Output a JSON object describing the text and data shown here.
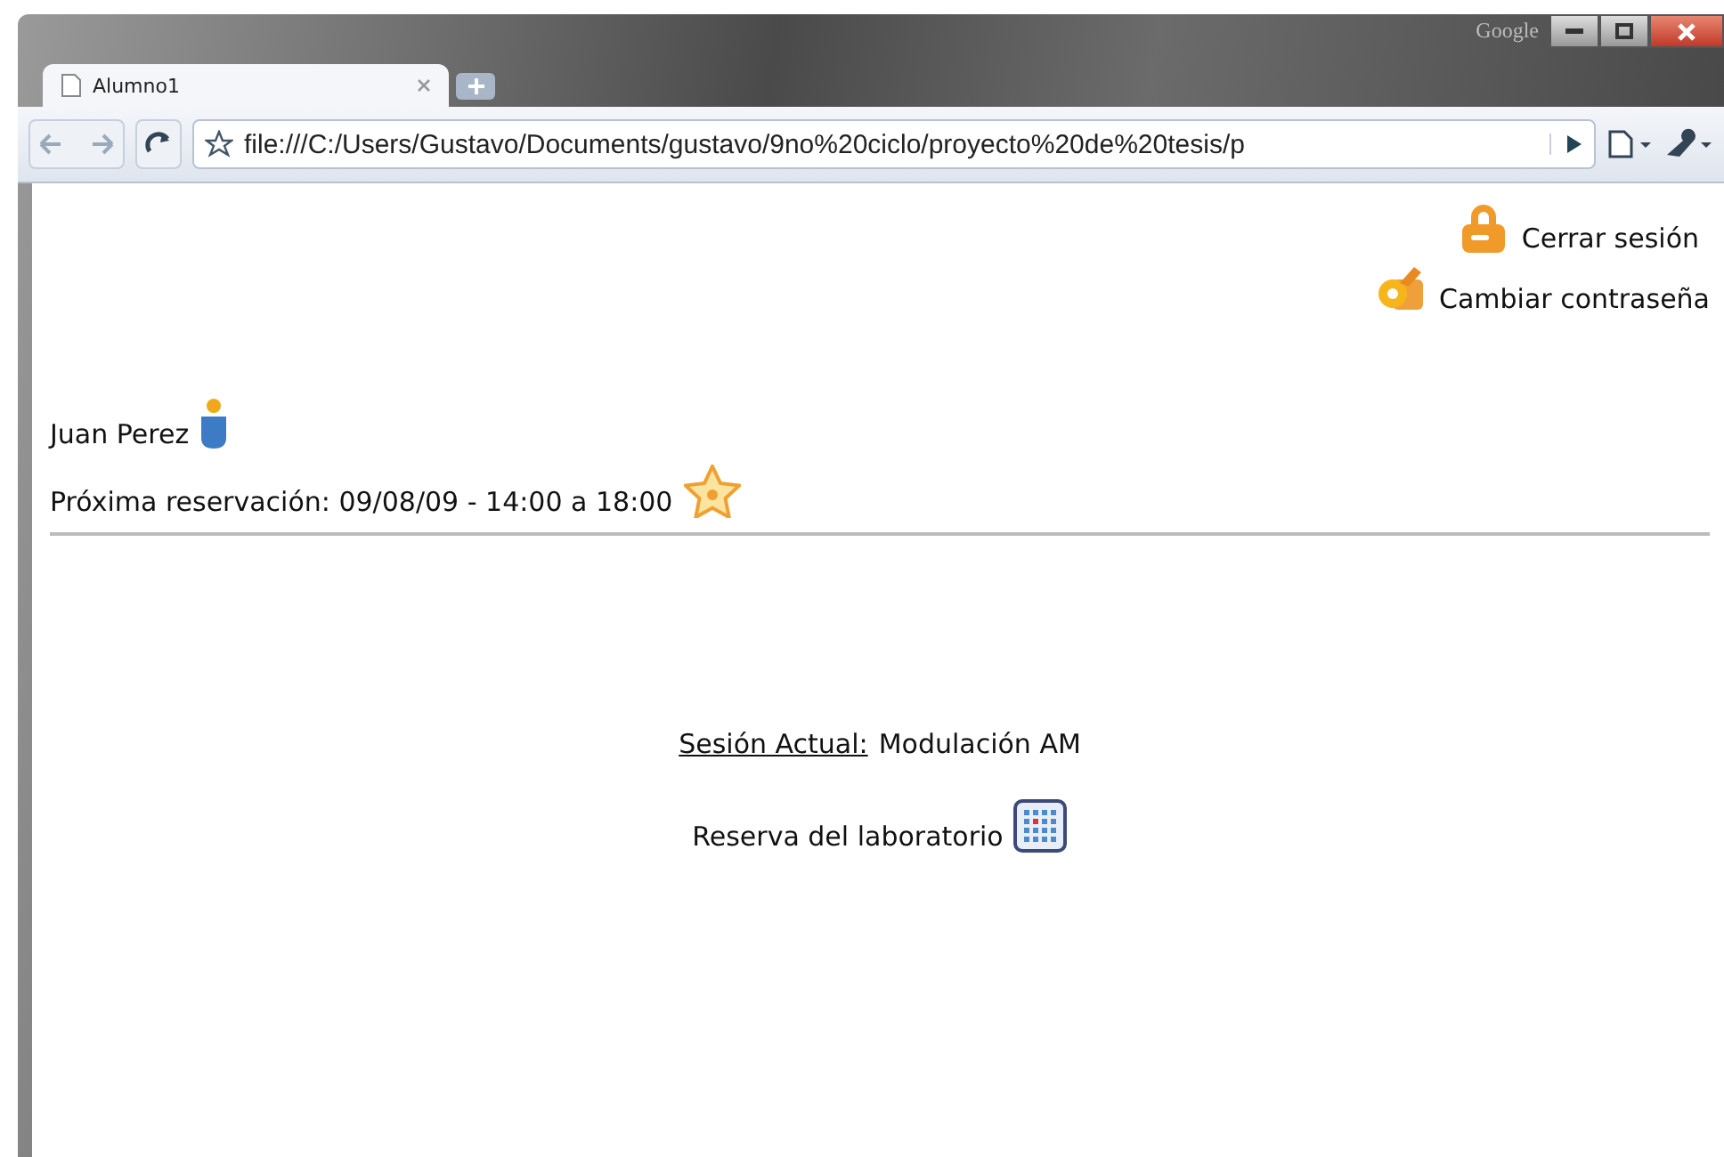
{
  "browser": {
    "tab": {
      "title": "Alumno1",
      "selected": true
    },
    "brand": "Google",
    "address": "file:///C:/Users/Gustavo/Documents/gustavo/9no%20ciclo/proyecto%20de%20tesis/p"
  },
  "header_links": [
    {
      "kind": "lock",
      "label": "Cerrar sesión"
    },
    {
      "kind": "keys",
      "label": "Cambiar contraseña"
    }
  ],
  "user": {
    "name": "Juan Perez"
  },
  "next_reservation": "Próxima reservación: 09/08/09 - 14:00 a 18:00",
  "session": {
    "label": "Sesión Actual:",
    "value": "Modulación AM"
  },
  "lab_link": "Reserva del laboratorio"
}
